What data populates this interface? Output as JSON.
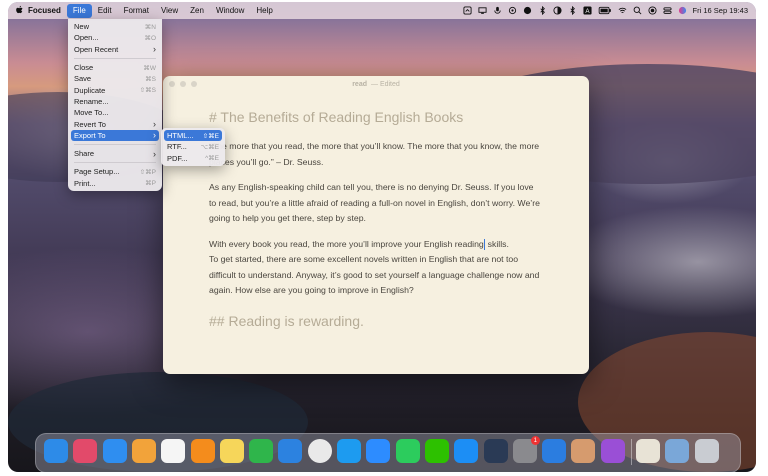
{
  "menubar": {
    "app_name": "Focused",
    "items": [
      "File",
      "Edit",
      "Format",
      "View",
      "Zen",
      "Window",
      "Help"
    ],
    "clock": "Fri 16 Sep  19:43"
  },
  "file_menu": {
    "items": [
      {
        "label": "New",
        "shortcut": "⌘N"
      },
      {
        "label": "Open...",
        "shortcut": "⌘O"
      },
      {
        "label": "Open Recent",
        "shortcut": "›"
      },
      {
        "label": "Close",
        "shortcut": "⌘W"
      },
      {
        "label": "Save",
        "shortcut": "⌘S"
      },
      {
        "label": "Duplicate",
        "shortcut": "⇧⌘S"
      },
      {
        "label": "Rename...",
        "shortcut": ""
      },
      {
        "label": "Move To...",
        "shortcut": ""
      },
      {
        "label": "Revert To",
        "shortcut": "›"
      },
      {
        "label": "Export To",
        "shortcut": "›"
      },
      {
        "label": "Share",
        "shortcut": "›"
      },
      {
        "label": "Page Setup...",
        "shortcut": "⇧⌘P"
      },
      {
        "label": "Print...",
        "shortcut": "⌘P"
      }
    ]
  },
  "export_submenu": {
    "items": [
      {
        "label": "HTML...",
        "shortcut": "⇧⌘E"
      },
      {
        "label": "RTF...",
        "shortcut": "⌥⌘E"
      },
      {
        "label": "PDF...",
        "shortcut": "^⌘E"
      }
    ]
  },
  "window": {
    "title": "read",
    "subtitle": "— Edited",
    "heading1": "# The Benefits of Reading English Books",
    "para1_before": "“The ",
    "para1_after": "more that you read, the more that you’ll know. The more that you know, the more places you’ll go.” – Dr. Seuss.",
    "para2": "As any English-speaking child can tell you, there is no denying Dr. Seuss. If you love to read, but you’re a little afraid of reading a full-on novel in English, don’t worry. We’re going to help you get there, step by step.",
    "para3_before": "With every book you read, the more you’ll improve your English reading",
    "para3_after": " skills.",
    "para4": "To get started, there are some excellent novels written in English that are not too difficult to understand. Anyway, it’s good to set yourself a language challenge now and again. How else are you going to improve in English?",
    "heading2": "## Reading is rewarding."
  },
  "dock": {
    "apps": [
      {
        "name": "finder",
        "color": "#2d8be8"
      },
      {
        "name": "launchpad",
        "color": "#e24a6a"
      },
      {
        "name": "safari",
        "color": "#2f8ef0"
      },
      {
        "name": "photos",
        "color": "#f2a33a"
      },
      {
        "name": "reminders",
        "color": "#f5f5f5"
      },
      {
        "name": "pages",
        "color": "#f48c1c"
      },
      {
        "name": "notes",
        "color": "#f6d65a"
      },
      {
        "name": "numbers",
        "color": "#2fb54b"
      },
      {
        "name": "keynote",
        "color": "#2c82e0"
      },
      {
        "name": "chrome",
        "color": "#e9e9e9"
      },
      {
        "name": "skype",
        "color": "#1d9bf0"
      },
      {
        "name": "zoom",
        "color": "#2d8cff"
      },
      {
        "name": "whatsapp",
        "color": "#2ccc5d"
      },
      {
        "name": "wechat",
        "color": "#2dc100"
      },
      {
        "name": "app-store",
        "color": "#1c8ef5"
      },
      {
        "name": "quicktime",
        "color": "#2a3a55"
      },
      {
        "name": "system-preferences",
        "color": "#8a8a8e"
      },
      {
        "name": "focused",
        "color": "#2b7de0"
      },
      {
        "name": "colorsync",
        "color": "#d69b6e"
      },
      {
        "name": "preview",
        "color": "#9a4fd6"
      },
      {
        "name": "downloads-folder",
        "color": "#e8e3d6"
      },
      {
        "name": "documents-folder",
        "color": "#7aa7d8"
      },
      {
        "name": "trash",
        "color": "#c9ccd2"
      }
    ],
    "system_prefs_badge": "1"
  }
}
